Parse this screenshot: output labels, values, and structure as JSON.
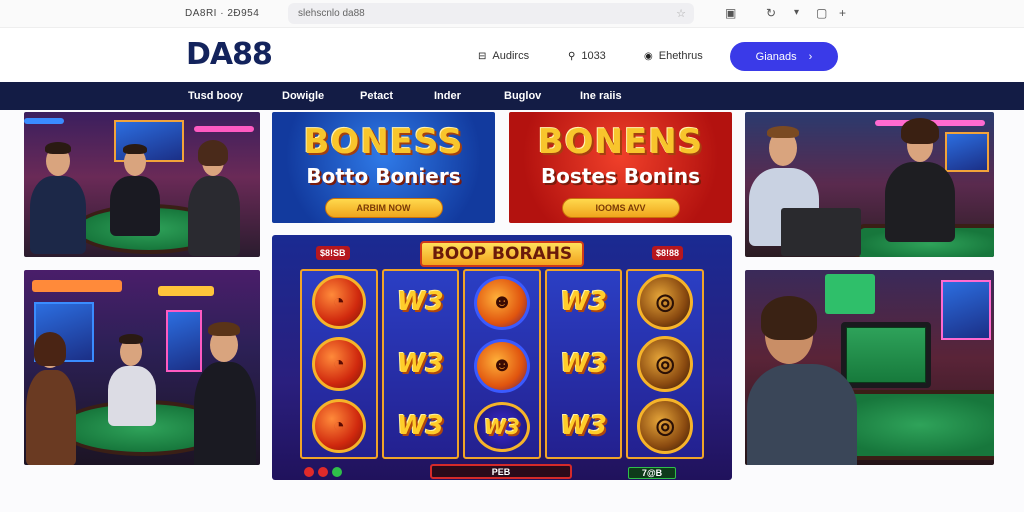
{
  "browser": {
    "tab_title": "DA8RI · 2Đ954",
    "url": "slehscnlo da88"
  },
  "header": {
    "logo": "DA88",
    "links": [
      {
        "icon": "user-icon",
        "label": "Audircs"
      },
      {
        "icon": "location-icon",
        "label": "1033"
      },
      {
        "icon": "settings-icon",
        "label": "Ehethrus"
      }
    ],
    "cta_label": "Gianads",
    "cta_arrow": "›"
  },
  "nav": {
    "items": [
      "Tusd booy",
      "Dowigle",
      "Petact",
      "Inder",
      "Buglov",
      "Ine raiis"
    ]
  },
  "banners": {
    "blue": {
      "line1": "BONESS",
      "line2": "Botto Boniers",
      "button": "ARBIM NOW"
    },
    "red": {
      "line1": "BONENS",
      "line2": "Bostes Bonins",
      "button": "IOOMS AVV"
    }
  },
  "slot": {
    "title": "BOOP BORAHS",
    "credit_left": "$8!SB",
    "credit_right": "$8!88",
    "bottom_label": "PEB",
    "win_label": "7@B",
    "symbol_w": "W3",
    "symbol_w_alt": "W3"
  },
  "colors": {
    "nav_bg": "#131c45",
    "cta_bg": "#3a3ae8",
    "logo": "#13235c",
    "slot_bg": "#1a2a92",
    "banner_blue": "#1552c9",
    "banner_red": "#d21f1f"
  }
}
